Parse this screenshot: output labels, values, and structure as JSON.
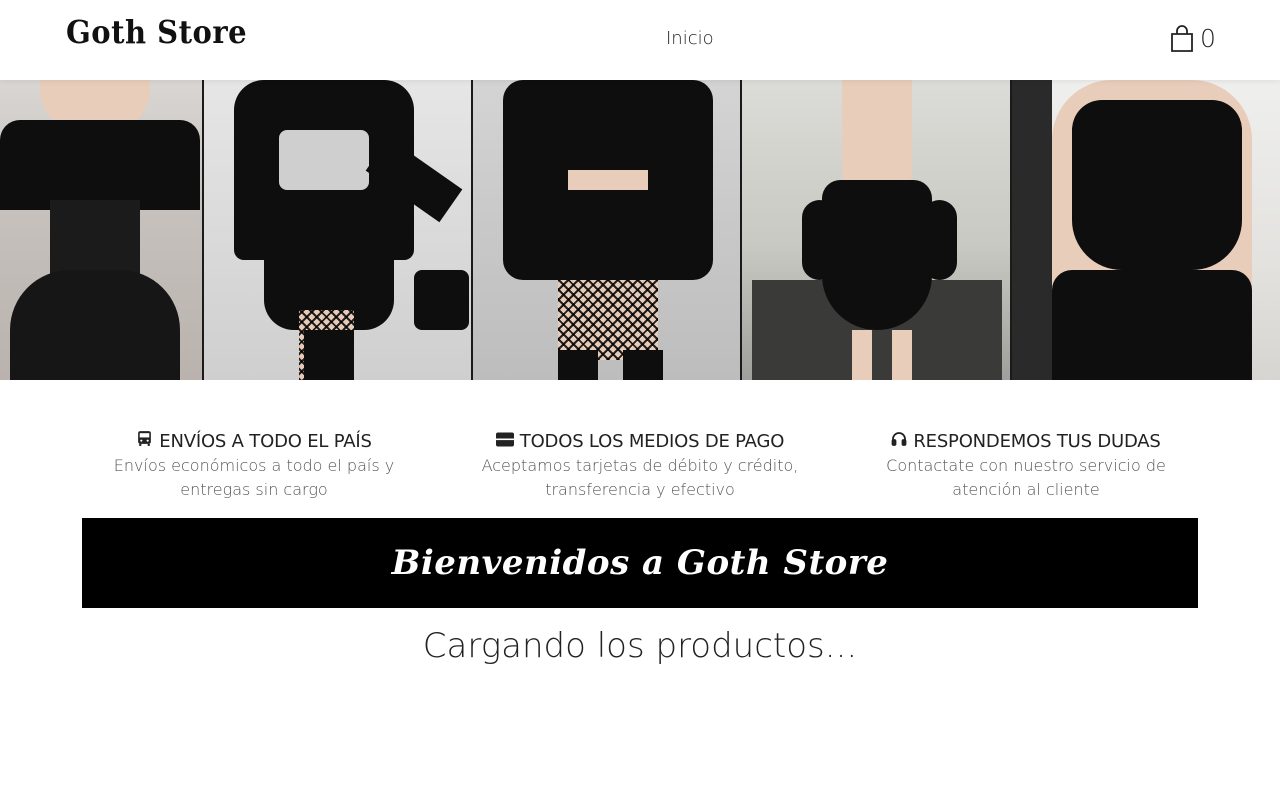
{
  "navbar": {
    "brand": "Goth Store",
    "links": [
      {
        "label": "Inicio"
      }
    ],
    "cart": {
      "count": "0",
      "icon": "shopping-bag-icon"
    }
  },
  "hero": {
    "panels": 5
  },
  "features": [
    {
      "icon": "bus-icon",
      "title": "ENVÍOS A TODO EL PAÍS",
      "description": "Envíos económicos a todo el país y entregas sin cargo"
    },
    {
      "icon": "credit-card-icon",
      "title": "TODOS LOS MEDIOS DE PAGO",
      "description": "Aceptamos tarjetas de débito y crédito, transferencia y efectivo"
    },
    {
      "icon": "headphones-icon",
      "title": "RESPONDEMOS TUS DUDAS",
      "description": "Contactate con nuestro servicio de atención al cliente"
    }
  ],
  "welcome": {
    "text": "Bienvenidos a Goth Store"
  },
  "loading": {
    "text": "Cargando los productos..."
  },
  "colors": {
    "banner_bg": "#000000",
    "banner_text": "#ffffff",
    "text_primary": "#222222",
    "text_secondary": "#555555"
  }
}
